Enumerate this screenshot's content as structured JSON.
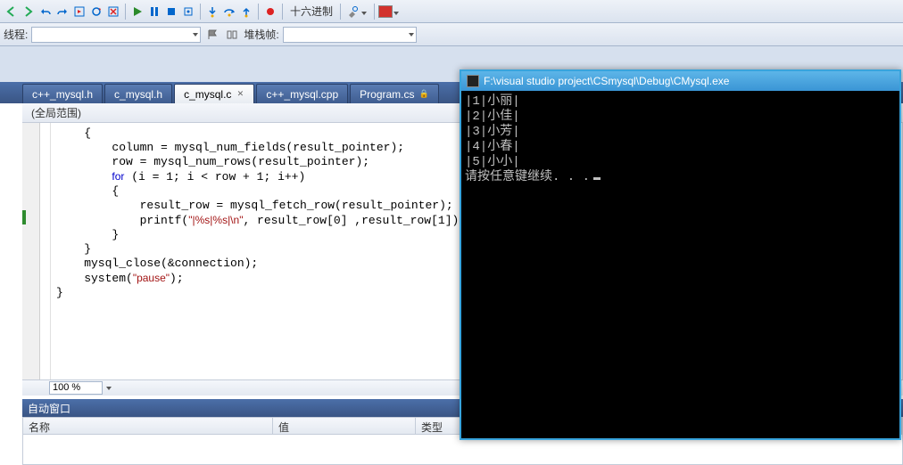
{
  "toolbar": {
    "hex_label": "十六进制"
  },
  "bar2": {
    "thread_label": "线程:",
    "stack_label": "堆栈帧:"
  },
  "tabs": [
    {
      "label": "c++_mysql.h",
      "active": false,
      "closable": false,
      "locked": false
    },
    {
      "label": "c_mysql.h",
      "active": false,
      "closable": false,
      "locked": false
    },
    {
      "label": "c_mysql.c",
      "active": true,
      "closable": true,
      "locked": false
    },
    {
      "label": "c++_mysql.cpp",
      "active": false,
      "closable": false,
      "locked": false
    },
    {
      "label": "Program.cs",
      "active": false,
      "closable": false,
      "locked": true
    }
  ],
  "scope": "(全局范围)",
  "code_lines": [
    "    {",
    "        column = mysql_num_fields(result_pointer);",
    "        row = mysql_num_rows(result_pointer);",
    "        for (i = 1; i < row + 1; i++)",
    "        {",
    "            result_row = mysql_fetch_row(result_pointer);",
    "            printf(\"|%s|%s|\\n\", result_row[0] ,result_row[1]);",
    "        }",
    "    }",
    "    mysql_close(&connection);",
    "    system(\"pause\");",
    "}"
  ],
  "zoom": "100 %",
  "panel": {
    "title": "自动窗口",
    "col_name": "名称",
    "col_value": "值",
    "col_type": "类型"
  },
  "console": {
    "title": "F:\\visual studio project\\CSmysql\\Debug\\CMysql.exe",
    "lines": [
      "|1|小丽|",
      "|2|小佳|",
      "|3|小芳|",
      "|4|小春|",
      "|5|小小|",
      "请按任意键继续. . ."
    ]
  }
}
